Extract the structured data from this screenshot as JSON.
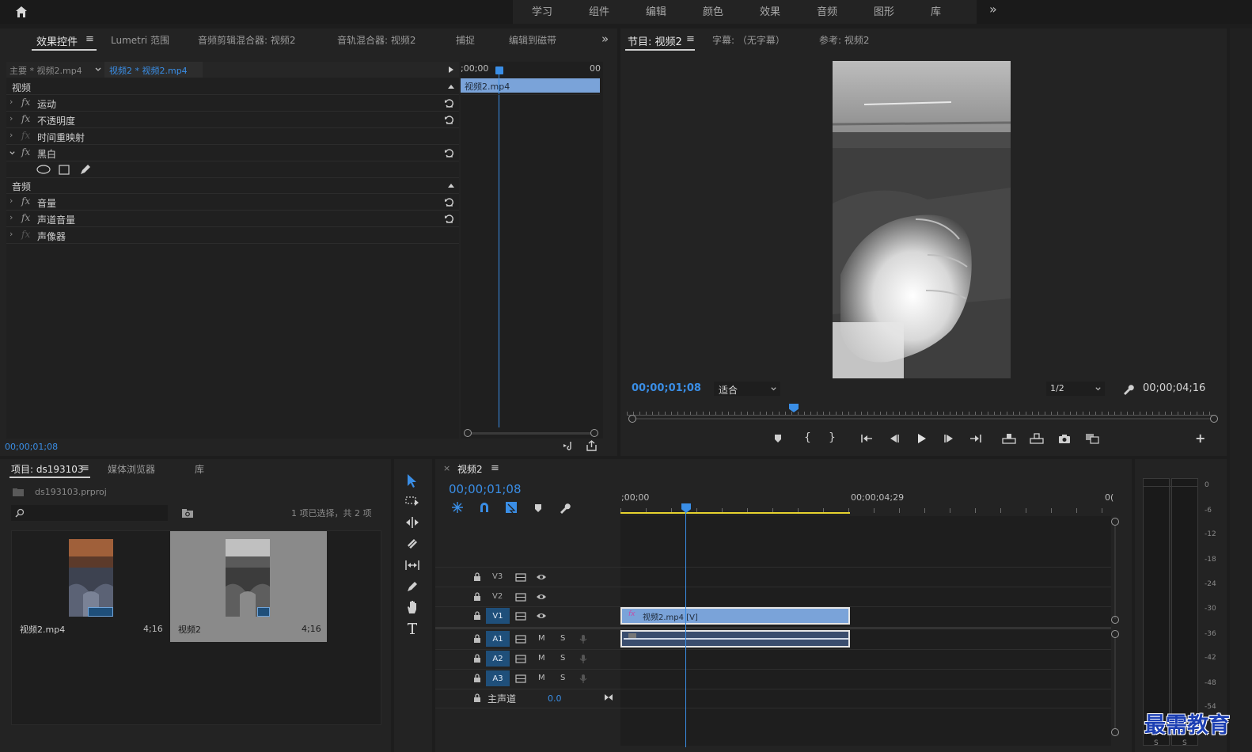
{
  "workspace": {
    "tabs": [
      "学习",
      "组件",
      "编辑",
      "颜色",
      "效果",
      "音频",
      "图形",
      "库"
    ],
    "more": "»"
  },
  "effects_panel": {
    "tabs": [
      "效果控件",
      "Lumetri 范围",
      "音频剪辑混合器: 视频2",
      "音轨混合器: 视频2",
      "捕捉",
      "编辑到磁带"
    ],
    "menu_icon": "≡",
    "more": "»",
    "master_clip": "主要 * 视频2.mp4",
    "sequence_clip": "视频2 * 视频2.mp4",
    "timecode_start": ";00;00",
    "timecode_end": "00",
    "clip_bar_label": "视频2.mp4",
    "video_section": "视频",
    "audio_section": "音频",
    "video_effects": [
      "运动",
      "不透明度",
      "时间重映射",
      "黑白"
    ],
    "audio_effects": [
      "音量",
      "声道音量",
      "声像器"
    ],
    "fx_label": "fx",
    "current_time": "00;00;01;08"
  },
  "program_monitor": {
    "tabs": [
      "节目: 视频2",
      "字幕: （无字幕）",
      "参考: 视频2"
    ],
    "menu_icon": "≡",
    "timecode": "00;00;01;08",
    "fit": "适合",
    "resolution": "1/2",
    "duration": "00;00;04;16"
  },
  "project_panel": {
    "tabs": [
      "项目: ds193103",
      "媒体浏览器",
      "库"
    ],
    "menu_icon": "≡",
    "project_file": "ds193103.prproj",
    "selection_info": "1 项已选择，共 2 项",
    "items": [
      {
        "name": "视频2.mp4",
        "duration": "4;16"
      },
      {
        "name": "视频2",
        "duration": "4;16"
      }
    ]
  },
  "timeline": {
    "close": "×",
    "title": "视频2",
    "menu_icon": "≡",
    "timecode": "00;00;01;08",
    "ruler_start": ";00;00",
    "ruler_mid": "00;00;04;29",
    "ruler_end": "0(",
    "video_tracks": [
      "V3",
      "V2",
      "V1"
    ],
    "audio_tracks": [
      "A1",
      "A2",
      "A3"
    ],
    "mute": "M",
    "solo": "S",
    "master_label": "主声道",
    "master_value": "0.0",
    "v1_clip": "视频2.mp4 [V]"
  },
  "audio_meter": {
    "scale": [
      "0",
      "-6",
      "-12",
      "-18",
      "-24",
      "-30",
      "-36",
      "-42",
      "-48",
      "-54"
    ],
    "solo_left": "S",
    "solo_right": "S"
  },
  "watermark": "最需教育",
  "colors": {
    "accent_blue": "#3a8ee6",
    "clip_blue": "#7aa3d9",
    "track_blue": "#1f4f7a",
    "work_area_yellow": "#e6d22e",
    "watermark_blue": "#1c3fb3"
  }
}
